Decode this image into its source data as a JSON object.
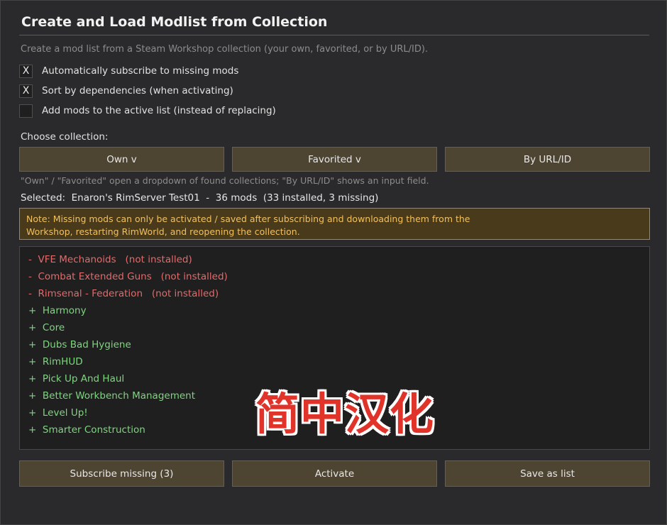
{
  "dialog": {
    "title": "Create and Load Modlist from Collection",
    "subtitle": "Create a mod list from a Steam Workshop collection (your own, favorited, or by URL/ID)."
  },
  "options": [
    {
      "label": "Automatically subscribe to missing mods",
      "checked": true,
      "mark": "X"
    },
    {
      "label": "Sort by dependencies (when activating)",
      "checked": true,
      "mark": "X"
    },
    {
      "label": "Add mods to the active list (instead of replacing)",
      "checked": false,
      "mark": ""
    }
  ],
  "collection": {
    "choose_label": "Choose collection:",
    "buttons": {
      "own": "Own  v",
      "favorited": "Favorited  v",
      "by_url": "By URL/ID"
    },
    "hint": "\"Own\" / \"Favorited\" open a dropdown of found collections; \"By URL/ID\" shows an input field.",
    "selected_text": "Selected:  Enaron's RimServer Test01  -  36 mods  (33 installed, 3 missing)"
  },
  "note": {
    "line1": "Note: Missing mods can only be activated / saved after subscribing and downloading them from the",
    "line2": "Workshop, restarting RimWorld, and reopening the collection."
  },
  "mods": [
    {
      "text": "-  VFE Mechanoids   (not installed)",
      "status": "missing"
    },
    {
      "text": "-  Combat Extended Guns   (not installed)",
      "status": "missing"
    },
    {
      "text": "-  Rimsenal - Federation   (not installed)",
      "status": "missing"
    },
    {
      "text": "+  Harmony",
      "status": "installed"
    },
    {
      "text": "+  Core",
      "status": "installed"
    },
    {
      "text": "+  Dubs Bad Hygiene",
      "status": "installed"
    },
    {
      "text": "+  RimHUD",
      "status": "installed"
    },
    {
      "text": "+  Pick Up And Haul",
      "status": "installed"
    },
    {
      "text": "+  Better Workbench Management",
      "status": "installed"
    },
    {
      "text": "+  Level Up!",
      "status": "installed"
    },
    {
      "text": "+  Smarter Construction",
      "status": "installed"
    }
  ],
  "actions": {
    "subscribe_missing": "Subscribe missing (3)",
    "activate": "Activate",
    "save_as_list": "Save as list"
  },
  "watermark": "简中汉化",
  "colors": {
    "background": "#2a2a2c",
    "button": "#4d4431",
    "missing": "#e46a6a",
    "installed": "#7fd67f",
    "note_text": "#f0c060",
    "note_border": "#a88a35"
  }
}
